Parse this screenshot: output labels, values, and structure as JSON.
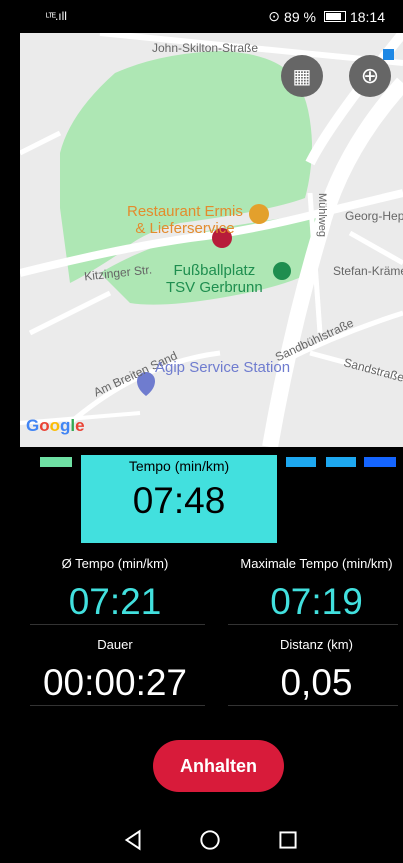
{
  "status": {
    "signal": "LTE",
    "battery": "89 %",
    "time": "18:14"
  },
  "map": {
    "streets": [
      "John-Skilton-Straße",
      "Mühlweg",
      "Georg-Heppe",
      "Kitzinger Str.",
      "Stefan-Krämer",
      "Sandbühlstraße",
      "Am Breiten Sand",
      "Sandstraße"
    ],
    "pois": {
      "restaurant": "Restaurant Ermis\n& Lieferservice",
      "football": "Fußballplatz\nTSV Gerbrunn",
      "agip": "Agip Service Station"
    },
    "google": [
      "G",
      "o",
      "o",
      "g",
      "l",
      "e"
    ],
    "colors": {
      "park": "#aee7b4",
      "road": "#ffffff",
      "poi_orange": "#e38b2d",
      "poi_green": "#1e8e4f",
      "poi_blue": "#6f7ccf"
    }
  },
  "legend": {
    "left_color": "#6fe0a4",
    "right_colors": [
      "#1ea8f0",
      "#1ea8f0",
      "#1565ff"
    ]
  },
  "tempo": {
    "label": "Tempo (min/km)",
    "value": "07:48",
    "color": "#42e0de"
  },
  "stats": {
    "avg_tempo": {
      "label": "Ø Tempo (min/km)",
      "value": "07:21",
      "color": "#42e0de"
    },
    "max_tempo": {
      "label": "Maximale Tempo (min/km)",
      "value": "07:19",
      "color": "#42e0de"
    },
    "duration": {
      "label": "Dauer",
      "value": "00:00:27"
    },
    "distance": {
      "label": "Distanz (km)",
      "value": "0,05"
    }
  },
  "stop_button": "Anhalten",
  "nav": {
    "back": "back-icon",
    "home": "home-icon",
    "recents": "recents-icon"
  }
}
